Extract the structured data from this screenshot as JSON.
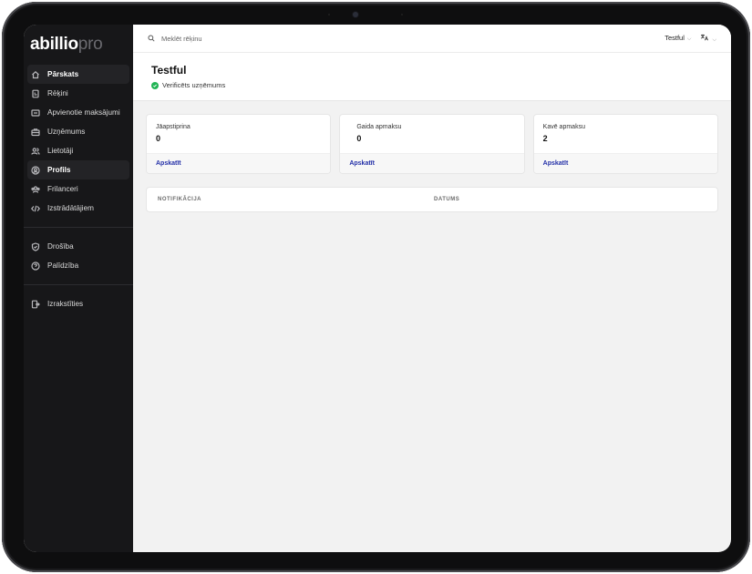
{
  "brand": {
    "logo_primary": "abillio",
    "logo_secondary": "pro"
  },
  "sidebar": {
    "items": [
      {
        "label": "Pārskats",
        "icon": "home-icon",
        "active": true
      },
      {
        "label": "Rēķini",
        "icon": "invoice-icon",
        "active": false
      },
      {
        "label": "Apvienotie maksājumi",
        "icon": "combined-payments-icon",
        "active": false
      },
      {
        "label": "Uzņēmums",
        "icon": "briefcase-icon",
        "active": false
      },
      {
        "label": "Lietotāji",
        "icon": "users-icon",
        "active": false
      },
      {
        "label": "Profils",
        "icon": "profile-icon",
        "active": true
      },
      {
        "label": "Frilanceri",
        "icon": "freelancers-icon",
        "active": false
      },
      {
        "label": "Izstrādātājiem",
        "icon": "code-icon",
        "active": false
      }
    ],
    "secondary": [
      {
        "label": "Drošība",
        "icon": "shield-icon"
      },
      {
        "label": "Palīdzība",
        "icon": "help-icon"
      }
    ],
    "logout": {
      "label": "Izrakstīties",
      "icon": "logout-icon"
    }
  },
  "topbar": {
    "search_placeholder": "Meklēt rēķinu",
    "company_selector": "Testful",
    "language_icon": "translate-icon"
  },
  "header": {
    "company_name": "Testful",
    "verified_text": "Verificēts uzņēmums"
  },
  "cards": [
    {
      "label": "Jāapstiprina",
      "value": "0",
      "link": "Apskatīt"
    },
    {
      "label": "Gaida apmaksu",
      "value": "0",
      "link": "Apskatīt"
    },
    {
      "label": "Kavē apmaksu",
      "value": "2",
      "link": "Apskatīt"
    }
  ],
  "table": {
    "columns": [
      "NOTIFIKĀCIJA",
      "DATUMS"
    ]
  },
  "colors": {
    "sidebar_bg": "#171719",
    "accent_link": "#2430a8",
    "verified_green": "#22b455"
  }
}
